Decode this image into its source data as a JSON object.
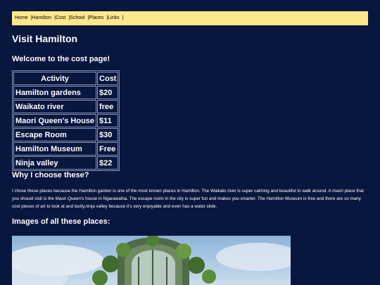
{
  "nav": {
    "items": [
      {
        "label": "Home"
      },
      {
        "label": "|Hamilton"
      },
      {
        "label": "|Cost"
      },
      {
        "label": "|School"
      },
      {
        "label": "|Places"
      },
      {
        "label": "|Links"
      },
      {
        "label": "|"
      }
    ]
  },
  "page": {
    "title": "Visit Hamilton",
    "welcome": "Welcome to the cost page!"
  },
  "table": {
    "headers": [
      "Activity",
      "Cost"
    ],
    "rows": [
      [
        "Hamilton gardens",
        "$20"
      ],
      [
        "Waikato river",
        "free"
      ],
      [
        "Maori Queen's House",
        "$11"
      ],
      [
        "Escape Room",
        "$30"
      ],
      [
        "Hamilton Museum",
        "Free"
      ],
      [
        "Ninja valley",
        "$22"
      ]
    ]
  },
  "why": {
    "heading": "Why I choose these?",
    "text": "I chose these places because the Hamilton garden is one of the most known places in Hamilton. The Waikato river is super calming and beautiful to walk around. A maori place that you should visit is the Maori Queen's house in Ngarawahia. The escape room in the city is super fun and makes you smarter. The Hamilton Museum is free and there are so many cool pieces of art to look at and lastly,ninja valley because it's very enjoyable and even has a water slide."
  },
  "images": {
    "heading": "Images of all these places:"
  },
  "colors": {
    "background": "#08173e",
    "navbar": "#fde88b"
  }
}
